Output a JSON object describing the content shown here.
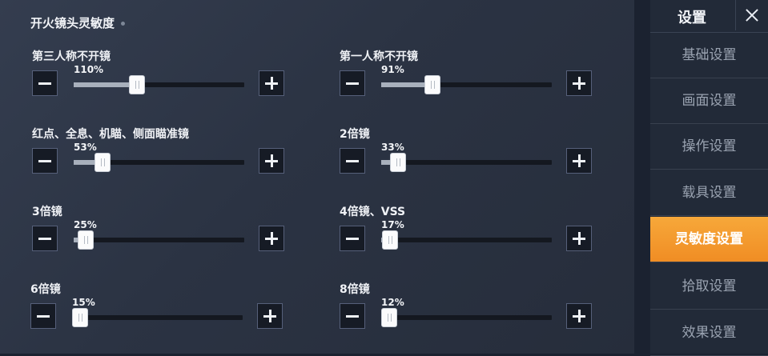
{
  "section_title": "开火镜头灵敏度",
  "settings": [
    {
      "label": "第三人称不开镜",
      "value_text": "110%",
      "level": 0.37
    },
    {
      "label": "第一人称不开镜",
      "value_text": "91%",
      "level": 0.3
    },
    {
      "label": "红点、全息、机瞄、侧面瞄准镜",
      "value_text": "53%",
      "level": 0.17
    },
    {
      "label": "2倍镜",
      "value_text": "33%",
      "level": 0.1
    },
    {
      "label": "3倍镜",
      "value_text": "25%",
      "level": 0.07
    },
    {
      "label": "4倍镜、VSS",
      "value_text": "17%",
      "level": 0.05
    },
    {
      "label": "6倍镜",
      "value_text": "15%",
      "level": 0.04
    },
    {
      "label": "8倍镜",
      "value_text": "12%",
      "level": 0.03
    }
  ],
  "sidebar": {
    "title": "设置",
    "items": [
      {
        "label": "基础设置"
      },
      {
        "label": "画面设置"
      },
      {
        "label": "操作设置"
      },
      {
        "label": "载具设置"
      },
      {
        "label": "灵敏度设置"
      },
      {
        "label": "拾取设置"
      },
      {
        "label": "效果设置"
      }
    ],
    "active_index": 4
  },
  "colors": {
    "accent": "#f29a2e",
    "panel": "#2e3646",
    "button": "#161b25"
  }
}
